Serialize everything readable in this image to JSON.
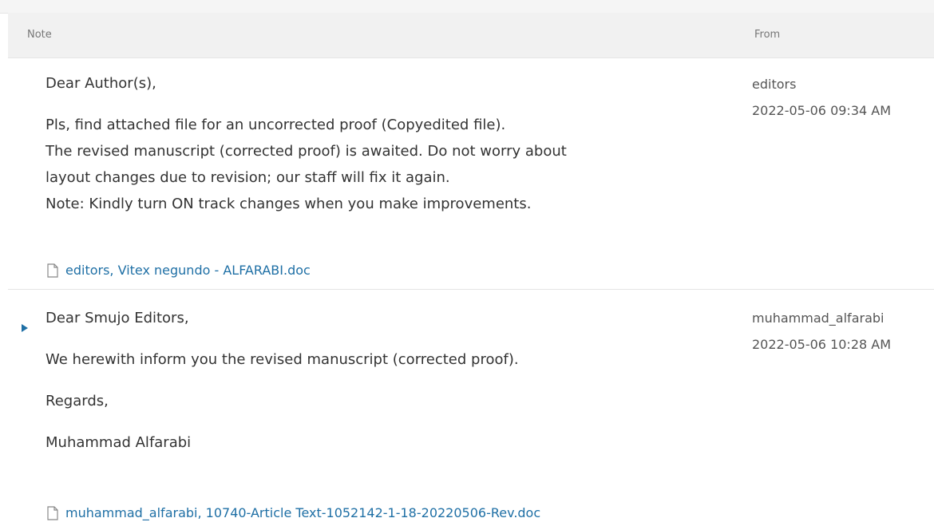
{
  "table": {
    "headers": {
      "note": "Note",
      "from": "From"
    }
  },
  "notes": [
    {
      "greeting": "Dear Author(s),",
      "lines": [
        "Pls, find attached file for an uncorrected proof (Copyedited file).",
        "The revised manuscript (corrected proof) is awaited. Do not worry about",
        "layout changes due to revision; our staff will fix it again.",
        "Note: Kindly turn ON track changes when you make improvements."
      ],
      "attachment": "editors, Vitex negundo - ALFARABI.doc",
      "author": "editors",
      "date": "2022-05-06 09:34 AM",
      "icon": "file-icon"
    },
    {
      "greeting": "Dear Smujo Editors,",
      "lines": [
        "We herewith inform you the revised manuscript (corrected proof).",
        "Regards,",
        "Muhammad Alfarabi"
      ],
      "attachment": "muhammad_alfarabi, 10740-Article Text-1052142-1-18-20220506-Rev.doc",
      "author": "muhammad_alfarabi",
      "date": "2022-05-06 10:28 AM",
      "icon": "file-icon",
      "toggle_icon": "expand-arrow-icon"
    }
  ],
  "colors": {
    "link": "#1e6fa5",
    "header_bg": "#f1f1f1",
    "text": "#333333"
  }
}
